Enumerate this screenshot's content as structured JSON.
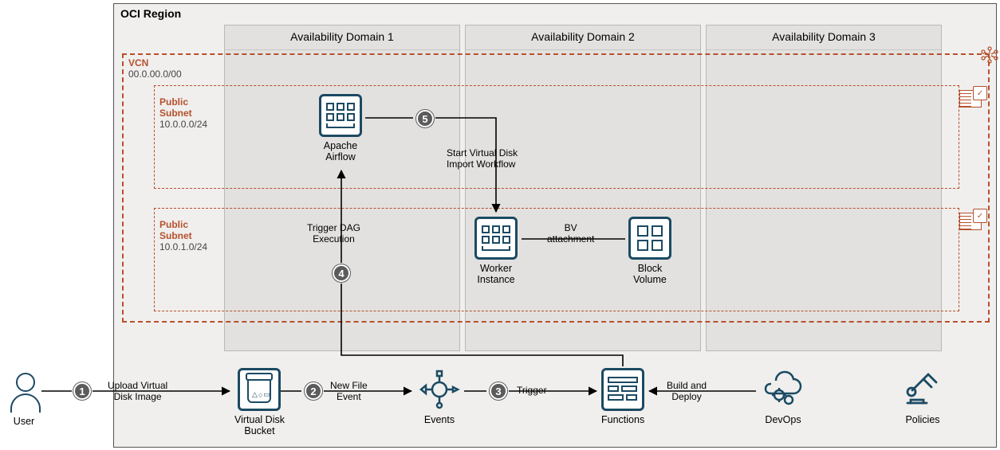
{
  "region": {
    "title": "OCI Region",
    "availability_domains": [
      {
        "label": "Availability Domain 1"
      },
      {
        "label": "Availability Domain 2"
      },
      {
        "label": "Availability Domain 3"
      }
    ],
    "vcn": {
      "label": "VCN",
      "cidr": "00.0.00.0/00",
      "subnets": [
        {
          "label": "Public\nSubnet",
          "cidr": "10.0.0.0/24"
        },
        {
          "label": "Public\nSubnet",
          "cidr": "10.0.1.0/24"
        }
      ]
    }
  },
  "nodes": {
    "user": "User",
    "virtual_disk_bucket": "Virtual Disk\nBucket",
    "events": "Events",
    "functions": "Functions",
    "devops": "DevOps",
    "policies": "Policies",
    "apache_airflow": "Apache\nAirflow",
    "worker_instance": "Worker\nInstance",
    "block_volume": "Block\nVolume"
  },
  "edges": {
    "upload_vd": "Upload Virtual\nDisk Image",
    "new_file_event": "New File\nEvent",
    "trigger": "Trigger",
    "build_deploy": "Build and\nDeploy",
    "trigger_dag": "Trigger DAG\nExecution",
    "start_workflow": "Start Virtual Disk\nImport Workflow",
    "bv_attach": "BV\nattachment"
  },
  "steps": {
    "1": "1",
    "2": "2",
    "3": "3",
    "4": "4",
    "5": "5"
  }
}
